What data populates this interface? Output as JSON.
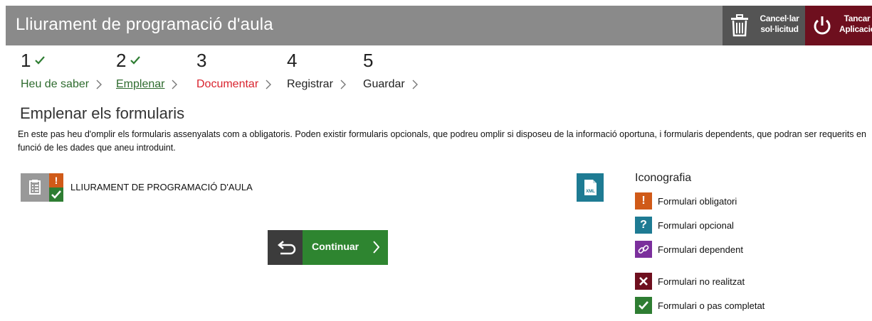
{
  "app": {
    "title": "Lliurament de programació d'aula",
    "cancel_label_1": "Cancel·lar",
    "cancel_label_2": "sol·licitud",
    "close_label_1": "Tancar",
    "close_label_2": "Aplicació"
  },
  "steps": [
    {
      "number": "1",
      "label": "Heu de saber",
      "status": "completed"
    },
    {
      "number": "2",
      "label": "Emplenar",
      "status": "current-completed"
    },
    {
      "number": "3",
      "label": "Documentar",
      "status": "pending"
    },
    {
      "number": "4",
      "label": "Registrar",
      "status": "todo"
    },
    {
      "number": "5",
      "label": "Guardar",
      "status": "todo"
    }
  ],
  "section": {
    "title": "Emplenar els formularis",
    "description": "En este pas heu d'omplir els formularis assenyalats com a obligatoris. Poden existir formularis opcionals, que podreu omplir si disposeu de la informació oportuna, i formularis dependents, que podran ser requerits en funció de les dades que aneu introduint."
  },
  "form": {
    "name": "LLIURAMENT DE PROGRAMACIÓ D'AULA",
    "mandatory_mark": "!",
    "xml_label": "XML"
  },
  "actions": {
    "continue_label": "Continuar"
  },
  "legend": {
    "title": "Iconografia",
    "items": [
      {
        "label": "Formulari obligatori",
        "symbol": "!",
        "color": "#d05a18"
      },
      {
        "label": "Formulari opcional",
        "symbol": "?",
        "color": "#1e7b93"
      },
      {
        "label": "Formulari dependent",
        "symbol": "link-icon",
        "color": "#7b2f9c"
      },
      {
        "label": "Formulari no realitzat",
        "symbol": "x-icon",
        "color": "#6e0f1e"
      },
      {
        "label": "Formulari o pas completat",
        "symbol": "check-icon",
        "color": "#2e7d32"
      }
    ]
  },
  "colors": {
    "header_bg": "#8a8a8a",
    "cancel_bg": "#545454",
    "close_bg": "#6e0f1e",
    "done_green": "#2e6b2e",
    "pending_red": "#d9232e",
    "continue_bg": "#2e8530"
  }
}
